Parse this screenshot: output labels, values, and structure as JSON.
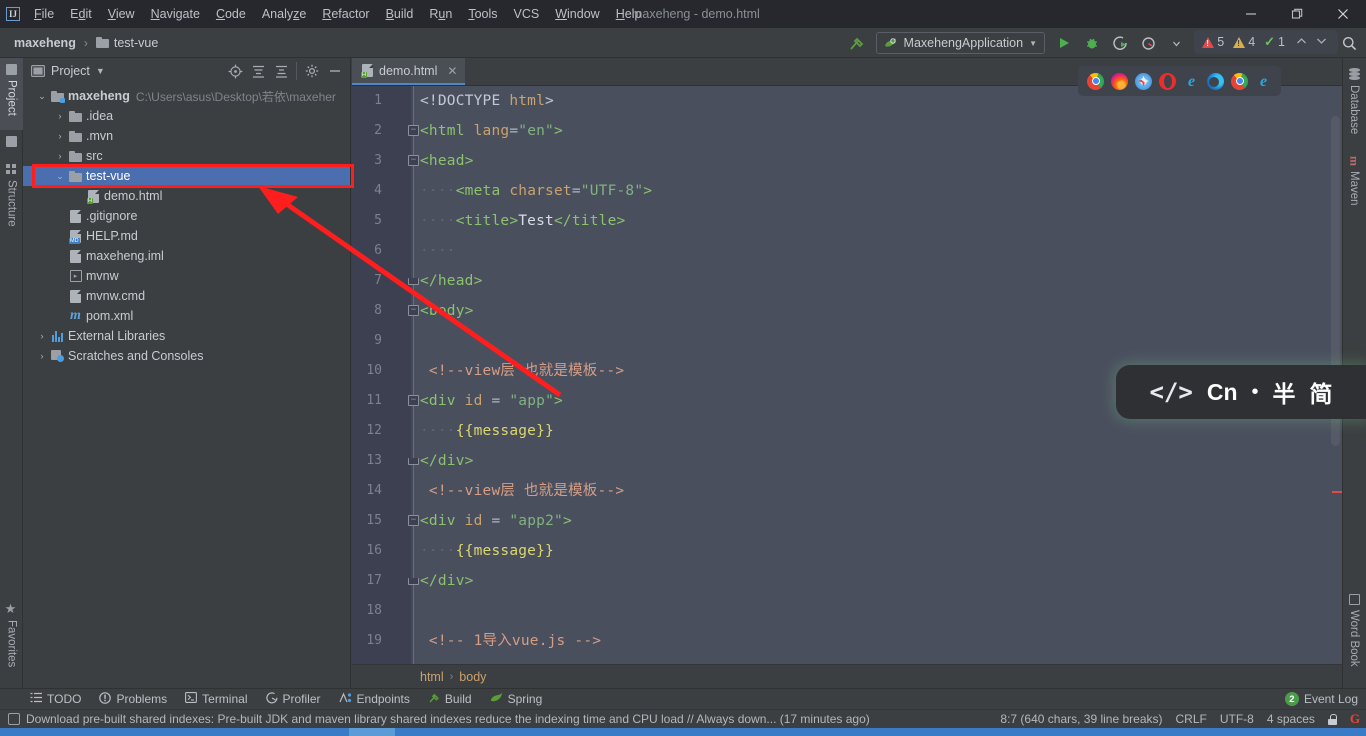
{
  "window": {
    "title": "maxeheng - demo.html",
    "logo": "ij-logo",
    "minimize": "—",
    "maximize": "❐",
    "close": "✕"
  },
  "menu": [
    {
      "label": "File"
    },
    {
      "label": "Edit"
    },
    {
      "label": "View"
    },
    {
      "label": "Navigate"
    },
    {
      "label": "Code"
    },
    {
      "label": "Analyze"
    },
    {
      "label": "Refactor"
    },
    {
      "label": "Build"
    },
    {
      "label": "Run"
    },
    {
      "label": "Tools"
    },
    {
      "label": "VCS"
    },
    {
      "label": "Window"
    },
    {
      "label": "Help"
    }
  ],
  "navbar": {
    "crumbs": [
      "maxeheng",
      "test-vue"
    ],
    "separator": "›",
    "run_config": "MaxehengApplication",
    "run_config_caret": "▼"
  },
  "left_strip": [
    {
      "label": "Project",
      "icon": "project-icon",
      "active": true
    },
    {
      "label": "Structure",
      "icon": "structure-icon",
      "active": false
    },
    {
      "label": "Favorites",
      "icon": "star-icon",
      "active": false
    }
  ],
  "right_strip": [
    {
      "label": "Database",
      "icon": "database-icon"
    },
    {
      "label": "Maven",
      "icon": "maven-icon"
    },
    {
      "label": "Word Book",
      "icon": "word-book-icon"
    }
  ],
  "project_panel": {
    "title": "Project",
    "caret": "▼",
    "tools": [
      "locate-icon",
      "expand-all-icon",
      "collapse-all-icon",
      "gear-icon",
      "hide-icon"
    ],
    "tree": [
      {
        "indent": 0,
        "arrow": "⌄",
        "icon": "module-folder-icon",
        "label": "maxeheng",
        "path": "C:\\Users\\asus\\Desktop\\若依\\maxeher",
        "bold": true,
        "selected": false
      },
      {
        "indent": 1,
        "arrow": "›",
        "icon": "folder-icon",
        "label": ".idea",
        "path": "",
        "bold": false,
        "selected": false
      },
      {
        "indent": 1,
        "arrow": "›",
        "icon": "folder-icon",
        "label": ".mvn",
        "path": "",
        "bold": false,
        "selected": false
      },
      {
        "indent": 1,
        "arrow": "›",
        "icon": "folder-icon",
        "label": "src",
        "path": "",
        "bold": false,
        "selected": false
      },
      {
        "indent": 1,
        "arrow": "⌄",
        "icon": "folder-icon",
        "label": "test-vue",
        "path": "",
        "bold": false,
        "selected": true
      },
      {
        "indent": 2,
        "arrow": "",
        "icon": "html-file-icon",
        "label": "demo.html",
        "path": "",
        "bold": false,
        "selected": false
      },
      {
        "indent": 1,
        "arrow": "",
        "icon": "gitignore-file-icon",
        "label": ".gitignore",
        "path": "",
        "bold": false,
        "selected": false
      },
      {
        "indent": 1,
        "arrow": "",
        "icon": "markdown-file-icon",
        "label": "HELP.md",
        "path": "",
        "bold": false,
        "selected": false
      },
      {
        "indent": 1,
        "arrow": "",
        "icon": "iml-file-icon",
        "label": "maxeheng.iml",
        "path": "",
        "bold": false,
        "selected": false
      },
      {
        "indent": 1,
        "arrow": "",
        "icon": "script-file-icon",
        "label": "mvnw",
        "path": "",
        "bold": false,
        "selected": false
      },
      {
        "indent": 1,
        "arrow": "",
        "icon": "cmd-file-icon",
        "label": "mvnw.cmd",
        "path": "",
        "bold": false,
        "selected": false
      },
      {
        "indent": 1,
        "arrow": "",
        "icon": "maven-pom-icon",
        "label": "pom.xml",
        "path": "",
        "bold": false,
        "selected": false
      },
      {
        "indent": 0,
        "arrow": "›",
        "icon": "external-libraries-icon",
        "label": "External Libraries",
        "path": "",
        "bold": false,
        "selected": false
      },
      {
        "indent": 0,
        "arrow": "›",
        "icon": "scratches-icon",
        "label": "Scratches and Consoles",
        "path": "",
        "bold": false,
        "selected": false
      }
    ]
  },
  "editor": {
    "tab": {
      "label": "demo.html",
      "icon": "html-file-icon",
      "close": "✕"
    },
    "breadcrumbs": [
      "html",
      "body"
    ],
    "breadcrumb_sep": "›",
    "inspections": {
      "errors": "5",
      "warnings": "4",
      "weak": "1",
      "up": "⌃",
      "down": "⌄"
    },
    "browsers": [
      "chrome-icon",
      "firefox-icon",
      "safari-icon",
      "opera-icon",
      "ie-icon",
      "edge-icon",
      "chrome-icon",
      "ie-icon"
    ],
    "lines": [
      {
        "n": "1",
        "fold": "",
        "tokens": [
          {
            "t": "<!DOCTYPE ",
            "c": "t-doctype"
          },
          {
            "t": "html",
            "c": "t-attr"
          },
          {
            "t": ">",
            "c": "t-doctype"
          }
        ]
      },
      {
        "n": "2",
        "fold": "minus",
        "tokens": [
          {
            "t": "<html",
            "c": "t-tag"
          },
          {
            "t": " ",
            "c": "t-punct"
          },
          {
            "t": "lang",
            "c": "t-attr"
          },
          {
            "t": "=",
            "c": "t-op"
          },
          {
            "t": "\"en\"",
            "c": "t-str"
          },
          {
            "t": ">",
            "c": "t-tag"
          }
        ]
      },
      {
        "n": "3",
        "fold": "minus",
        "tokens": [
          {
            "t": "<head>",
            "c": "t-tag"
          }
        ]
      },
      {
        "n": "4",
        "fold": "",
        "tokens": [
          {
            "t": "····",
            "c": "dots"
          },
          {
            "t": "<meta",
            "c": "t-tag"
          },
          {
            "t": " ",
            "c": "t-punct"
          },
          {
            "t": "charset",
            "c": "t-attr"
          },
          {
            "t": "=",
            "c": "t-op"
          },
          {
            "t": "\"UTF-8\"",
            "c": "t-str"
          },
          {
            "t": ">",
            "c": "t-tag"
          }
        ]
      },
      {
        "n": "5",
        "fold": "",
        "tokens": [
          {
            "t": "····",
            "c": "dots"
          },
          {
            "t": "<title>",
            "c": "t-tag"
          },
          {
            "t": "Test",
            "c": "t-text"
          },
          {
            "t": "</title>",
            "c": "t-tag"
          }
        ]
      },
      {
        "n": "6",
        "fold": "",
        "tokens": [
          {
            "t": "····",
            "c": "dots"
          }
        ]
      },
      {
        "n": "7",
        "fold": "end",
        "tokens": [
          {
            "t": "</head>",
            "c": "t-tag"
          }
        ]
      },
      {
        "n": "8",
        "fold": "minus",
        "tokens": [
          {
            "t": "<body>",
            "c": "t-tag"
          }
        ]
      },
      {
        "n": "9",
        "fold": "",
        "tokens": []
      },
      {
        "n": "10",
        "fold": "",
        "tokens": [
          {
            "t": " <!--view层 也就是模板-->",
            "c": "t-comment"
          }
        ]
      },
      {
        "n": "11",
        "fold": "minus",
        "tokens": [
          {
            "t": "<div",
            "c": "t-tag"
          },
          {
            "t": " ",
            "c": "t-punct"
          },
          {
            "t": "id",
            "c": "t-attr"
          },
          {
            "t": " = ",
            "c": "t-op"
          },
          {
            "t": "\"app\"",
            "c": "t-str"
          },
          {
            "t": ">",
            "c": "t-tag"
          }
        ]
      },
      {
        "n": "12",
        "fold": "",
        "tokens": [
          {
            "t": "····",
            "c": "dots"
          },
          {
            "t": "{{message}}",
            "c": "t-mustache"
          }
        ]
      },
      {
        "n": "13",
        "fold": "end",
        "tokens": [
          {
            "t": "</div>",
            "c": "t-tag"
          }
        ]
      },
      {
        "n": "14",
        "fold": "",
        "tokens": [
          {
            "t": " <!--view层 也就是模板-->",
            "c": "t-comment"
          }
        ]
      },
      {
        "n": "15",
        "fold": "minus",
        "tokens": [
          {
            "t": "<div",
            "c": "t-tag"
          },
          {
            "t": " ",
            "c": "t-punct"
          },
          {
            "t": "id",
            "c": "t-attr"
          },
          {
            "t": " = ",
            "c": "t-op"
          },
          {
            "t": "\"app2\"",
            "c": "t-str"
          },
          {
            "t": ">",
            "c": "t-tag"
          }
        ]
      },
      {
        "n": "16",
        "fold": "",
        "tokens": [
          {
            "t": "····",
            "c": "dots"
          },
          {
            "t": "{{message}}",
            "c": "t-mustache"
          }
        ]
      },
      {
        "n": "17",
        "fold": "end",
        "tokens": [
          {
            "t": "</div>",
            "c": "t-tag"
          }
        ]
      },
      {
        "n": "18",
        "fold": "",
        "tokens": []
      },
      {
        "n": "19",
        "fold": "",
        "tokens": [
          {
            "t": " <!-- 1导入vue.js -->",
            "c": "t-comment"
          }
        ]
      }
    ]
  },
  "ime": {
    "code": "</>",
    "lang": "Cn",
    "dot": "•",
    "width": "半",
    "script": "简"
  },
  "bottom_tools": [
    {
      "label": "TODO",
      "icon": "todo-icon"
    },
    {
      "label": "Problems",
      "icon": "problems-icon"
    },
    {
      "label": "Terminal",
      "icon": "terminal-icon"
    },
    {
      "label": "Profiler",
      "icon": "profiler-icon"
    },
    {
      "label": "Endpoints",
      "icon": "endpoints-icon"
    },
    {
      "label": "Build",
      "icon": "build-icon"
    },
    {
      "label": "Spring",
      "icon": "spring-icon"
    }
  ],
  "event_log": {
    "label": "Event Log",
    "count": "2"
  },
  "status_bar": {
    "message": "Download pre-built shared indexes: Pre-built JDK and maven library shared indexes reduce the indexing time and CPU load // Always down... (17 minutes ago)",
    "caret": "8:7 (640 chars, 39 line breaks)",
    "line_sep": "CRLF",
    "encoding": "UTF-8",
    "indent": "4 spaces",
    "lock_icon": "lock-icon",
    "google_icon": "google-icon"
  },
  "colors": {
    "accent_blue": "#4b6eaf",
    "annotation_red": "#ff1e1e",
    "tab_underline": "#4a88c7",
    "editor_bg": "#4a4f5e",
    "gutter_bg": "#3c4050"
  }
}
